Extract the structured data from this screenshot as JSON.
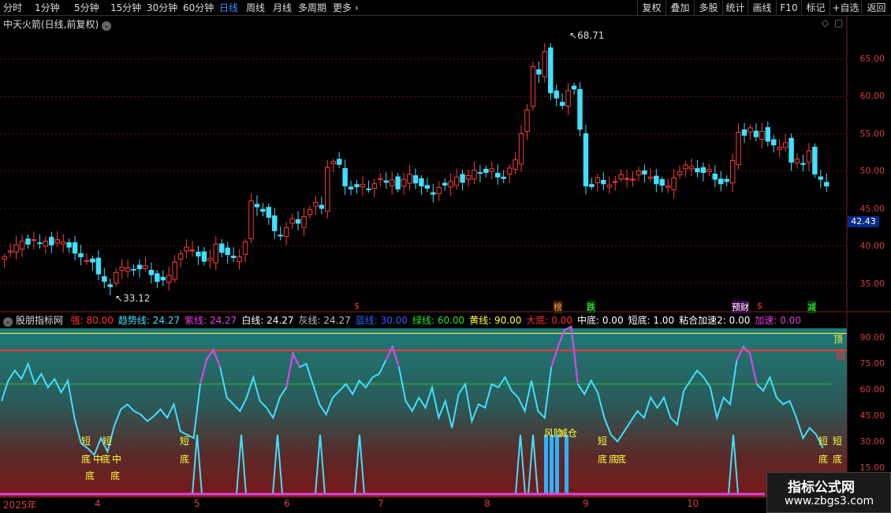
{
  "toolbar": {
    "periods": [
      "分时",
      "1分钟",
      "5分钟",
      "15分钟",
      "30分钟",
      "60分钟",
      "日线",
      "周线",
      "月线",
      "多周期"
    ],
    "active_period": "日线",
    "more": "更多",
    "right_buttons": [
      "复权",
      "叠加",
      "多股",
      "统计",
      "画线",
      "F10",
      "标记",
      "+自选",
      "返回"
    ]
  },
  "main_chart": {
    "stock_title": "中天火箭(日线,前复权)",
    "y_ticks": [
      "65.00",
      "60.00",
      "55.00",
      "50.00",
      "45.00",
      "40.00",
      "35.00"
    ],
    "current_price_tag": "42.43",
    "high_label": "68.71",
    "low_label": "33.12",
    "event_marks": [
      "$",
      "榜",
      "跌",
      "预财",
      "$",
      "减"
    ]
  },
  "indicator": {
    "name": "股朋指标网",
    "legend": [
      {
        "label": "强: 80.00",
        "color": "#ff3030"
      },
      {
        "label": "趋势线: 24.27",
        "color": "#40e0ff"
      },
      {
        "label": "紫线: 24.27",
        "color": "#e040e0"
      },
      {
        "label": "白线: 24.27",
        "color": "#ffffff"
      },
      {
        "label": "灰线: 24.27",
        "color": "#c0c0c0"
      },
      {
        "label": "蓝线: 30.00",
        "color": "#3060ff"
      },
      {
        "label": "绿线: 60.00",
        "color": "#30e030"
      },
      {
        "label": "黄线: 90.00",
        "color": "#ffff40"
      },
      {
        "label": "大底: 0.00",
        "color": "#ff3030"
      },
      {
        "label": "中底: 0.00",
        "color": "#ffffff"
      },
      {
        "label": "短底: 1.00",
        "color": "#ffffff"
      },
      {
        "label": "粘合加速2: 0.00",
        "color": "#ffffff"
      },
      {
        "label": "加速: 0.00",
        "color": "#e040e0"
      }
    ],
    "y_ticks": [
      "90.00",
      "75.00",
      "60.00",
      "45.00",
      "30.00",
      "15.00"
    ],
    "level_labels": {
      "top": "顶",
      "strong": "强"
    },
    "annotations": [
      "短",
      "底",
      "中",
      "底",
      "短",
      "中",
      "底",
      "底",
      "短",
      "底",
      "风险",
      "减仓",
      "短",
      "底",
      "底",
      "底",
      "短",
      "底",
      "短",
      "底"
    ]
  },
  "x_axis": {
    "labels": [
      "2025年",
      "4",
      "5",
      "6",
      "7",
      "8",
      "9",
      "10"
    ]
  },
  "watermark": {
    "title": "指标公式网",
    "url": "www.zbgs3.com"
  },
  "colors": {
    "up": "#ff3c3c",
    "down": "#40e0ff",
    "trend": "#40e0ff",
    "purple": "#e040e0",
    "yellow": "#ffff40",
    "green": "#30c030",
    "strong": "#ff3030"
  }
}
